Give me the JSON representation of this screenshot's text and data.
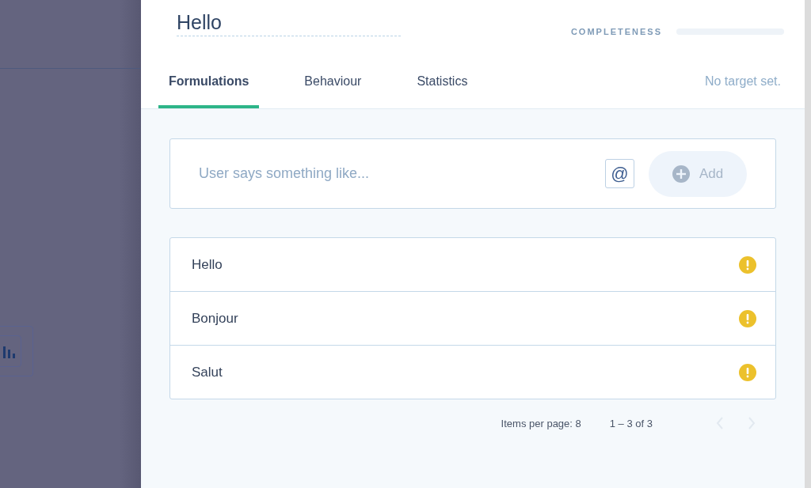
{
  "intent": {
    "title": "Hello",
    "completeness_label": "COMPLETENESS",
    "completeness": {
      "level": 0
    }
  },
  "tabs": [
    {
      "label": "Formulations",
      "selected": true
    },
    {
      "label": "Behaviour",
      "selected": false
    },
    {
      "label": "Statistics",
      "selected": false
    }
  ],
  "target_note": "No target set.",
  "composer": {
    "placeholder": "User says something like...",
    "mention_button": "@",
    "add_button": "Add",
    "add_disabled": true
  },
  "formulations": [
    {
      "text": "Hello",
      "warning": true
    },
    {
      "text": "Bonjour",
      "warning": true
    },
    {
      "text": "Salut",
      "warning": true
    }
  ],
  "pagination": {
    "items_per_page": "Items per page: 8",
    "range": "1 – 3 of 3",
    "prev_disabled": true,
    "next_disabled": true
  }
}
